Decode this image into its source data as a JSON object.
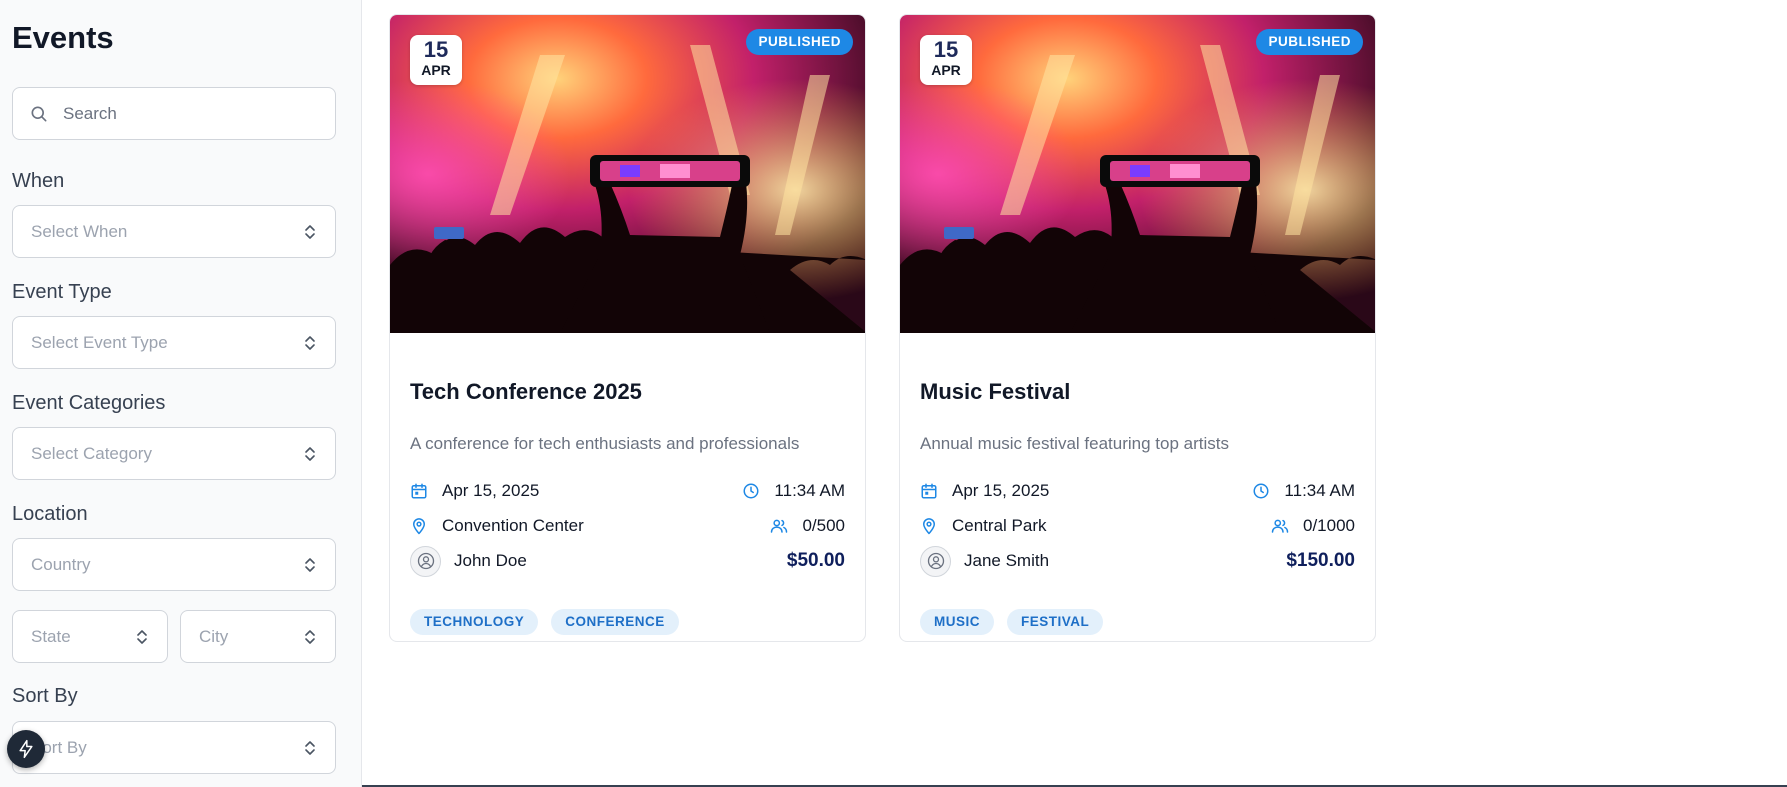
{
  "sidebar": {
    "title": "Events",
    "search": {
      "placeholder": "Search",
      "value": ""
    },
    "filters": {
      "when": {
        "label": "When",
        "placeholder": "Select When"
      },
      "event_type": {
        "label": "Event Type",
        "placeholder": "Select Event Type"
      },
      "categories": {
        "label": "Event Categories",
        "placeholder": "Select Category"
      },
      "location": {
        "label": "Location",
        "country_placeholder": "Country",
        "state_placeholder": "State",
        "city_placeholder": "City"
      },
      "sort_by": {
        "label": "Sort By",
        "placeholder": "Sort By"
      }
    }
  },
  "events": [
    {
      "day": "15",
      "month": "APR",
      "status": "PUBLISHED",
      "title": "Tech Conference 2025",
      "description": "A conference for tech enthusiasts and professionals",
      "date": "Apr 15, 2025",
      "time": "11:34 AM",
      "venue": "Convention Center",
      "capacity": "0/500",
      "organizer": "John Doe",
      "price": "$50.00",
      "tags": [
        "TECHNOLOGY",
        "CONFERENCE"
      ]
    },
    {
      "day": "15",
      "month": "APR",
      "status": "PUBLISHED",
      "title": "Music Festival",
      "description": "Annual music festival featuring top artists",
      "date": "Apr 15, 2025",
      "time": "11:34 AM",
      "venue": "Central Park",
      "capacity": "0/1000",
      "organizer": "Jane Smith",
      "price": "$150.00",
      "tags": [
        "MUSIC",
        "FESTIVAL"
      ]
    }
  ],
  "colors": {
    "accent": "#1e88e5",
    "price": "#0f1f5c",
    "tag_bg": "#e3f0fb",
    "tag_text": "#1e6fc7"
  }
}
